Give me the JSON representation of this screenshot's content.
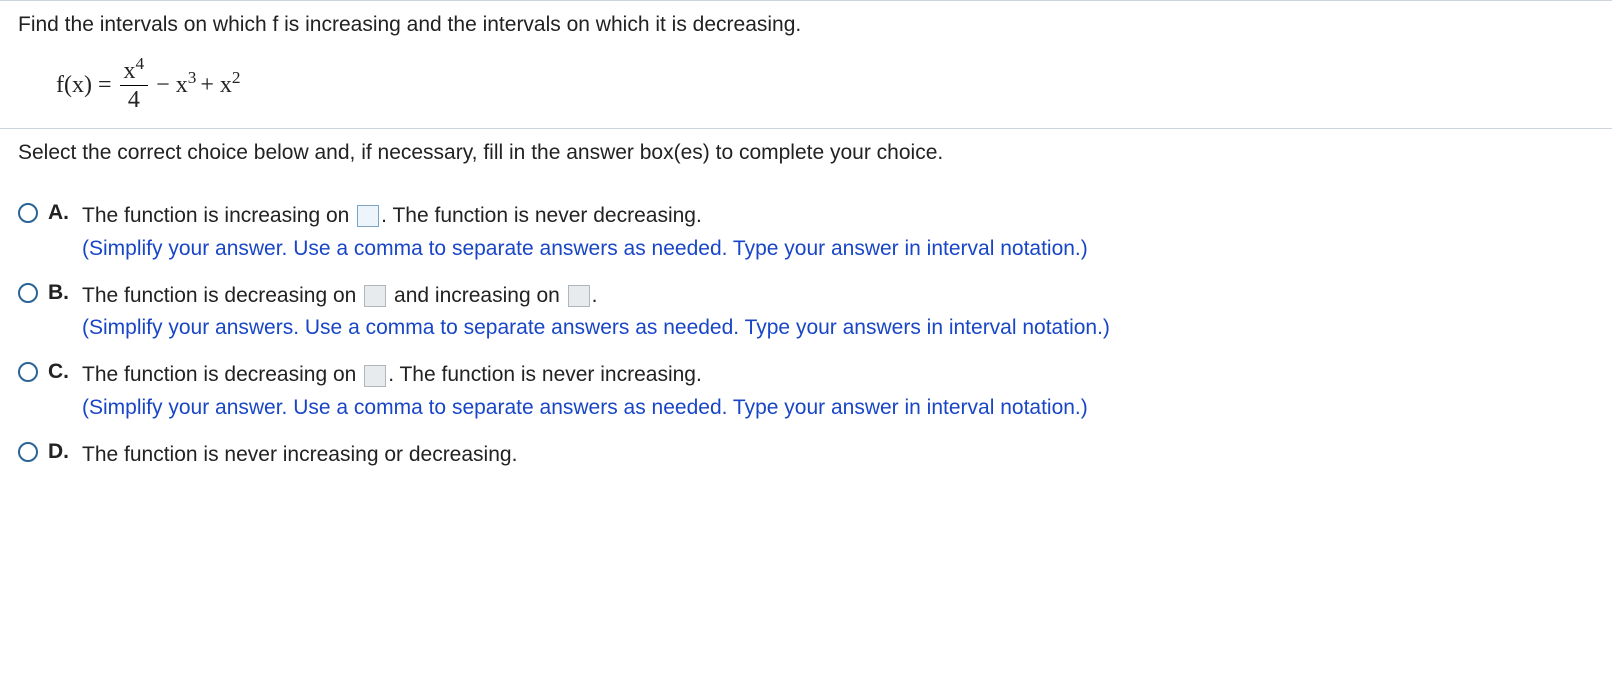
{
  "question": {
    "prompt": "Find the intervals on which f is increasing and the intervals on which it is decreasing.",
    "equation": {
      "lhs": "f(x) =",
      "frac_num": "x",
      "frac_num_sup": "4",
      "frac_den": "4",
      "minus": "− x",
      "sup3": "3",
      "plus": "+ x",
      "sup2": "2"
    }
  },
  "instruction": "Select the correct choice below and, if necessary, fill in the answer box(es) to complete your choice.",
  "choices": {
    "A": {
      "letter": "A.",
      "text1": "The function is increasing on",
      "text2": ". The function is never decreasing.",
      "hint": "(Simplify your answer. Use a comma to separate answers as needed. Type your answer in interval notation.)"
    },
    "B": {
      "letter": "B.",
      "text1": "The function is decreasing on",
      "text2": "and increasing on",
      "text3": ".",
      "hint": "(Simplify your answers. Use a comma to separate answers as needed. Type your answers in interval notation.)"
    },
    "C": {
      "letter": "C.",
      "text1": "The function is decreasing on",
      "text2": ". The function is never increasing.",
      "hint": "(Simplify your answer. Use a comma to separate answers as needed. Type your answer in interval notation.)"
    },
    "D": {
      "letter": "D.",
      "text": "The function is never increasing or decreasing."
    }
  }
}
